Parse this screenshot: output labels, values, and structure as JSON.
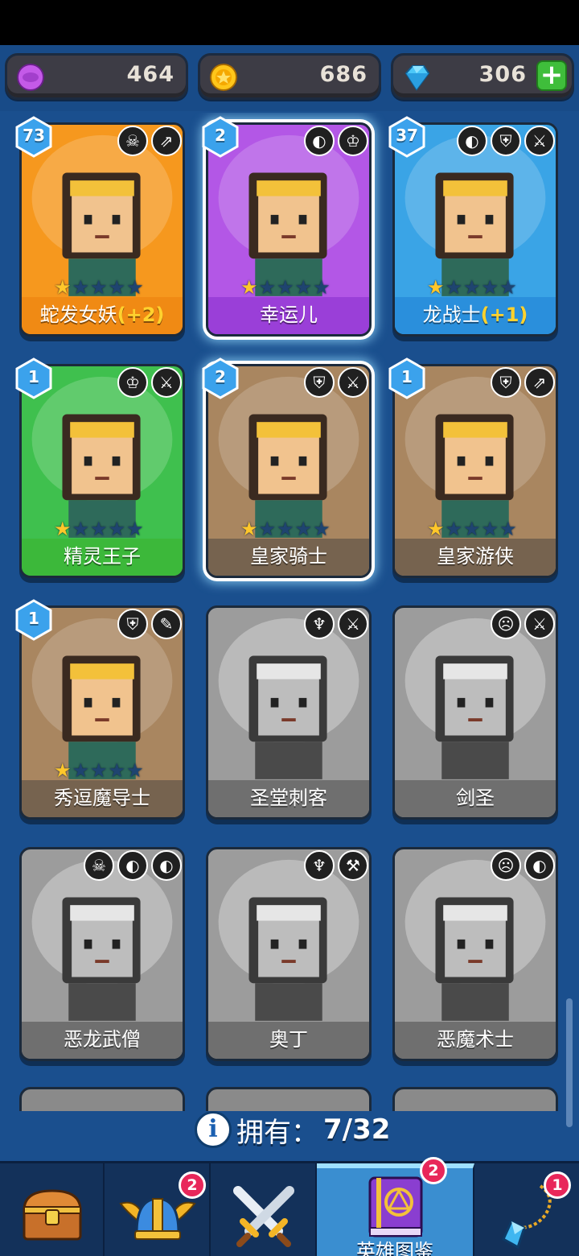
{
  "resources": {
    "potion": {
      "value": "464",
      "icon": "purple-token-icon",
      "color": "#a24bd0"
    },
    "gold": {
      "value": "686",
      "icon": "gold-coin-icon",
      "color": "#f5b500"
    },
    "gems": {
      "value": "306",
      "icon": "blue-gem-icon",
      "color": "#35b7f0",
      "add": "+"
    }
  },
  "heroes": [
    {
      "name": "蛇发女妖",
      "bonus": "(+2)",
      "level": "73",
      "stars": 1,
      "owned": true,
      "bg": "#f6981e",
      "bar": "#f08a14",
      "badges": [
        "☠",
        "⇗"
      ]
    },
    {
      "name": "幸运儿",
      "bonus": "",
      "level": "2",
      "stars": 1,
      "owned": true,
      "bg": "#b357e6",
      "bar": "#9a3fd8",
      "badges": [
        "◐",
        "♔"
      ],
      "selected": true
    },
    {
      "name": "龙战士",
      "bonus": "(+1)",
      "level": "37",
      "stars": 1,
      "owned": true,
      "bg": "#3aa4e6",
      "bar": "#2a8fdc",
      "badges": [
        "◐",
        "⛨",
        "⚔"
      ]
    },
    {
      "name": "精灵王子",
      "bonus": "",
      "level": "1",
      "stars": 1,
      "owned": true,
      "bg": "#3fc04e",
      "bar": "#3cb83a",
      "badges": [
        "♔",
        "⚔"
      ]
    },
    {
      "name": "皇家骑士",
      "bonus": "",
      "level": "2",
      "stars": 1,
      "owned": true,
      "bg": "#a98660",
      "bar": "#76634f",
      "badges": [
        "⛨",
        "⚔"
      ],
      "selected": true
    },
    {
      "name": "皇家游侠",
      "bonus": "",
      "level": "1",
      "stars": 1,
      "owned": true,
      "bg": "#a98660",
      "bar": "#76634f",
      "badges": [
        "⛨",
        "⇗"
      ]
    },
    {
      "name": "秀逗魔导士",
      "bonus": "",
      "level": "1",
      "stars": 1,
      "owned": true,
      "bg": "#a98660",
      "bar": "#76634f",
      "badges": [
        "⛨",
        "✎"
      ]
    },
    {
      "name": "圣堂刺客",
      "bonus": "",
      "level": "",
      "stars": 0,
      "owned": false,
      "bg": "#9c9c9c",
      "bar": "#6f6f6f",
      "badges": [
        "♆",
        "⚔"
      ]
    },
    {
      "name": "剑圣",
      "bonus": "",
      "level": "",
      "stars": 0,
      "owned": false,
      "bg": "#9c9c9c",
      "bar": "#6f6f6f",
      "badges": [
        "☹",
        "⚔"
      ]
    },
    {
      "name": "恶龙武僧",
      "bonus": "",
      "level": "",
      "stars": 0,
      "owned": false,
      "bg": "#9c9c9c",
      "bar": "#6f6f6f",
      "badges": [
        "☠",
        "◐",
        "◐"
      ]
    },
    {
      "name": "奥丁",
      "bonus": "",
      "level": "",
      "stars": 0,
      "owned": false,
      "bg": "#9c9c9c",
      "bar": "#6f6f6f",
      "badges": [
        "♆",
        "⚒"
      ]
    },
    {
      "name": "恶魔术士",
      "bonus": "",
      "level": "",
      "stars": 0,
      "owned": false,
      "bg": "#9c9c9c",
      "bar": "#6f6f6f",
      "badges": [
        "☹",
        "◐"
      ]
    }
  ],
  "collection": {
    "label": "拥有：",
    "count": "7/32",
    "info": "i"
  },
  "nav": {
    "tabs": [
      {
        "name": "chest",
        "icon": "treasure-chest-icon"
      },
      {
        "name": "heroes",
        "icon": "winged-helmet-icon",
        "badge": "2"
      },
      {
        "name": "battle",
        "icon": "crossed-swords-icon"
      },
      {
        "name": "hero-book",
        "icon": "spell-book-icon",
        "badge": "2",
        "label": "英雄图鉴",
        "active": true
      },
      {
        "name": "amulet",
        "icon": "amulet-icon",
        "badge": "1"
      }
    ]
  }
}
